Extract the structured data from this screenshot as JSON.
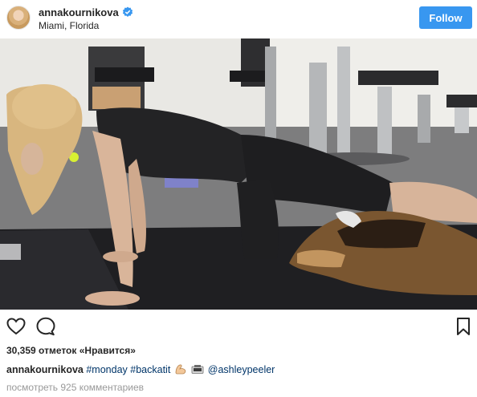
{
  "header": {
    "username": "annakournikova",
    "verified": true,
    "location": "Miami, Florida",
    "follow_label": "Follow",
    "accent_color": "#3897f0"
  },
  "photo": {
    "alt": "Woman doing floor exercise on a mat in a home gym with a German Shepherd dog lying underneath"
  },
  "actions": {
    "icons": [
      "heart-icon",
      "comment-icon",
      "bookmark-icon"
    ]
  },
  "likes": {
    "text": "30,359 отметок «Нравится»"
  },
  "caption": {
    "username": "annakournikova",
    "tag_monday": "#monday",
    "tag_backatit": "#backatit",
    "emojis": [
      "flexed-biceps-emoji",
      "camera-emoji"
    ],
    "mention": "@ashleypeeler"
  },
  "comments_link": {
    "text": "посмотреть 925 комментариев"
  }
}
